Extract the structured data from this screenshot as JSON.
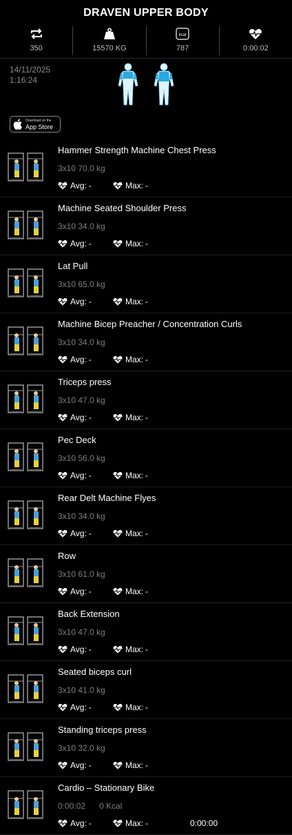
{
  "title": "DRAVEN UPPER BODY",
  "stats": [
    {
      "icon": "repeat-icon",
      "value": "350"
    },
    {
      "icon": "weight-icon",
      "value": "15570 KG"
    },
    {
      "icon": "kcal-icon",
      "icon_text": "kcal",
      "value": "787"
    },
    {
      "icon": "heartbeat-icon",
      "value": "0:00:02"
    }
  ],
  "date": "14/11/2025",
  "time": "1:16:24",
  "appstore": {
    "line1": "Download on the",
    "line2": "App Store"
  },
  "hr_labels": {
    "avg": "Avg:",
    "max": "Max:",
    "empty": "-"
  },
  "exercises": [
    {
      "name": "Hammer Strength Machine Chest Press",
      "detail": "3x10 70.0 kg"
    },
    {
      "name": "Machine Seated Shoulder Press",
      "detail": "3x10 34.0 kg"
    },
    {
      "name": "Lat Pull",
      "detail": "3x10 65.0 kg"
    },
    {
      "name": "Machine Bicep Preacher / Concentration Curls",
      "detail": "3x10 34.0 kg"
    },
    {
      "name": "Triceps press",
      "detail": "3x10 47.0 kg"
    },
    {
      "name": "Pec Deck",
      "detail": "3x10 56.0 kg"
    },
    {
      "name": "Rear Delt Machine Flyes",
      "detail": "3x10 34.0 kg"
    },
    {
      "name": "Row",
      "detail": "3x10 61.0 kg"
    },
    {
      "name": "Back Extension",
      "detail": "3x10 47.0 kg"
    },
    {
      "name": "Seated biceps curl",
      "detail": "3x10 41.0 kg"
    },
    {
      "name": "Standing triceps press",
      "detail": "3x10 32.0 kg"
    },
    {
      "name": "Cardio – Stationary Bike",
      "detail": "0:00:02",
      "detail2": "0 Kcal",
      "duration": "0:00:00"
    }
  ]
}
